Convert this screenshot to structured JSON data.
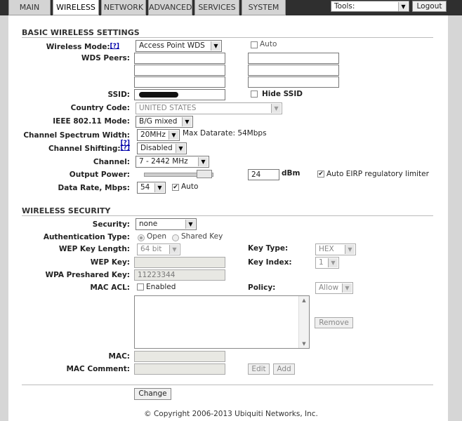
{
  "tabs": [
    "MAIN",
    "WIRELESS",
    "NETWORK",
    "ADVANCED",
    "SERVICES",
    "SYSTEM"
  ],
  "tools": {
    "value": "Tools:",
    "logout": "Logout"
  },
  "basic": {
    "title": "BASIC WIRELESS SETTINGS",
    "help": "[?]",
    "wireless_mode_label": "Wireless Mode:",
    "wireless_mode_value": "Access Point WDS",
    "auto_label": "Auto",
    "wds_peers_label": "WDS Peers:",
    "ssid_label": "SSID:",
    "hide_ssid": "Hide SSID",
    "country_label": "Country Code:",
    "country_value": "UNITED STATES",
    "ieee_label": "IEEE 802.11 Mode:",
    "ieee_value": "B/G mixed",
    "spectrum_label": "Channel Spectrum Width:",
    "spectrum_value": "20MHz",
    "max_datarate": "Max Datarate: 54Mbps",
    "shifting_label": "Channel Shifting:",
    "shifting_value": "Disabled",
    "channel_label": "Channel:",
    "channel_value": "7 - 2442 MHz",
    "output_label": "Output Power:",
    "output_value": "24",
    "output_unit": "dBm",
    "eirp_label": "Auto EIRP regulatory limiter",
    "datarate_label": "Data Rate, Mbps:",
    "datarate_value": "54",
    "datarate_auto": "Auto"
  },
  "security": {
    "title": "WIRELESS SECURITY",
    "security_label": "Security:",
    "security_value": "none",
    "auth_label": "Authentication Type:",
    "auth_open": "Open",
    "auth_shared": "Shared Key",
    "wep_len_label": "WEP Key Length:",
    "wep_len_value": "64 bit",
    "key_type_label": "Key Type:",
    "key_type_value": "HEX",
    "wep_key_label": "WEP Key:",
    "key_index_label": "Key Index:",
    "key_index_value": "1",
    "wpa_label": "WPA Preshared Key:",
    "wpa_value": "11223344",
    "mac_acl_label": "MAC ACL:",
    "mac_acl_enabled": "Enabled",
    "policy_label": "Policy:",
    "policy_value": "Allow",
    "remove": "Remove",
    "mac_label": "MAC:",
    "mac_comment_label": "MAC Comment:",
    "edit": "Edit",
    "add": "Add"
  },
  "change": "Change",
  "footer": "© Copyright 2006-2013 Ubiquiti Networks, Inc."
}
